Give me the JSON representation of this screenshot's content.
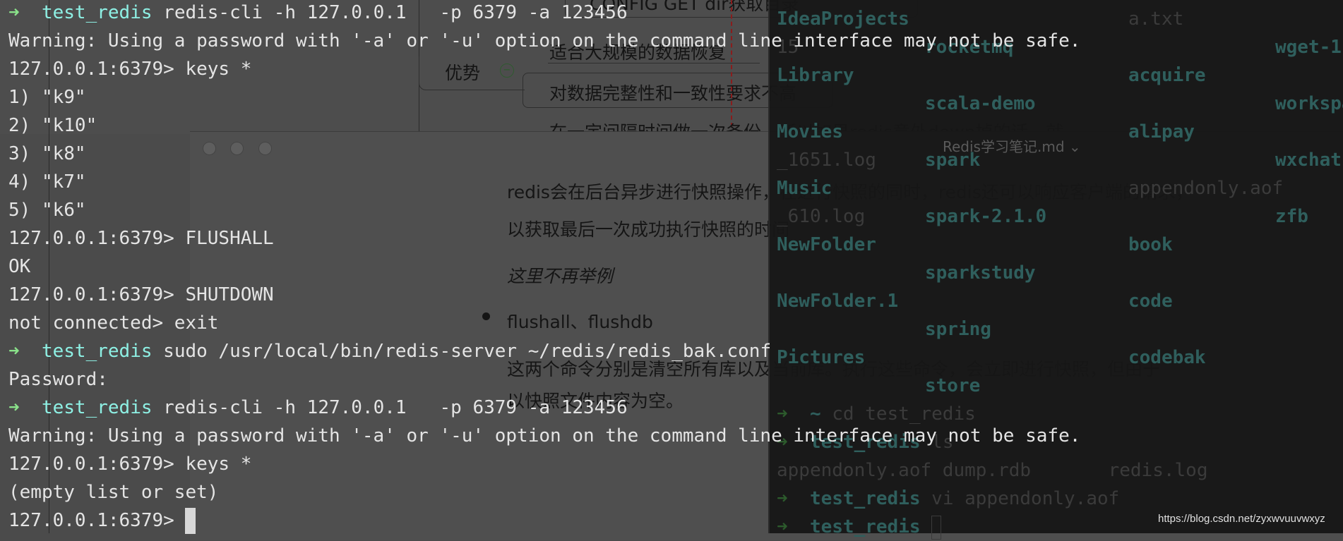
{
  "mindmap": {
    "top_box": "CONFIG GET dir获取目录",
    "item_recovery": "适合大规模的数据恢复",
    "advantage_label": "优势",
    "collapse_icon": "minus-circle-icon",
    "item_integrity": "对数据完整性和一致性要求不高",
    "partial_line": "在一定间隔时间做一次备份，所以如果redis意外down掉的话，就"
  },
  "markdown_window": {
    "title": "Redis学习笔记.md ⌄",
    "paragraph1": "redis会在后台异步进行快照操作，在进行快照的同时，redis还可以响应客户端的请求，",
    "paragraph1b": "以获取最后一次成功执行快照的时间",
    "italic_note": "这里不再举例",
    "bullet": "flushall、flushdb",
    "paragraph2": "这两个命令分别是清空所有库以及当前库。执行这些命令，会立即进行快照，但由于",
    "paragraph2b": "以快照文件内容为空。"
  },
  "background_terminal": {
    "ls_rows": [
      [
        [
          "IdeaProjects",
          "dir"
        ],
        null,
        [
          "a.txt",
          "file"
        ],
        null
      ],
      [
        [
          "15",
          "file"
        ],
        [
          "rocketmq",
          "dir"
        ],
        null,
        [
          "wget-1",
          "dir"
        ]
      ],
      [
        [
          "Library",
          "dir"
        ],
        null,
        [
          "acquire",
          "dir"
        ],
        null
      ],
      [
        null,
        [
          "scala-demo",
          "dir"
        ],
        null,
        [
          "workspa",
          "dir"
        ]
      ],
      [
        [
          "Movies",
          "dir"
        ],
        null,
        [
          "alipay",
          "dir"
        ],
        null
      ],
      [
        [
          "_1651.log",
          "file"
        ],
        [
          "spark",
          "dir"
        ],
        null,
        [
          "wxchat",
          "dir"
        ]
      ],
      [
        [
          "Music",
          "dir"
        ],
        null,
        [
          "appendonly.aof",
          "file"
        ],
        null
      ],
      [
        [
          "_610.log",
          "file"
        ],
        [
          "spark-2.1.0",
          "dir"
        ],
        null,
        [
          "zfb",
          "dir"
        ]
      ],
      [
        [
          "NewFolder",
          "dir"
        ],
        null,
        [
          "book",
          "dir"
        ],
        null
      ],
      [
        null,
        [
          "sparkstudy",
          "dir"
        ],
        null,
        null
      ],
      [
        [
          "NewFolder.1",
          "dir"
        ],
        null,
        [
          "code",
          "dir"
        ],
        null
      ],
      [
        null,
        [
          "spring",
          "dir"
        ],
        null,
        null
      ],
      [
        [
          "Pictures",
          "dir"
        ],
        null,
        [
          "codebak",
          "dir"
        ],
        null
      ],
      [
        null,
        [
          "store",
          "dir"
        ],
        null,
        null
      ]
    ],
    "history": [
      {
        "arrow": "➜",
        "dir": "~",
        "text": " cd test_redis"
      },
      {
        "arrow": "➜",
        "dir": "test_redis",
        "text": " ls"
      },
      {
        "text": "appendonly.aof dump.rdb       redis.log"
      },
      {
        "arrow": "➜",
        "dir": "test_redis",
        "text": " vi appendonly.aof"
      },
      {
        "arrow": "➜",
        "dir": "test_redis",
        "text": " ",
        "cursor": true
      }
    ]
  },
  "terminal": {
    "lines": [
      {
        "arrow": "➜",
        "dir": "test_redis",
        "text": " redis-cli -h 127.0.0.1   -p 6379 -a 123456"
      },
      {
        "text": "Warning: Using a password with '-a' or '-u' option on the command line interface may not be safe."
      },
      {
        "text": "127.0.0.1:6379> keys *"
      },
      {
        "text": "1) \"k9\""
      },
      {
        "text": "2) \"k10\""
      },
      {
        "text": "3) \"k8\""
      },
      {
        "text": "4) \"k7\""
      },
      {
        "text": "5) \"k6\""
      },
      {
        "text": "127.0.0.1:6379> FLUSHALL"
      },
      {
        "text": "OK"
      },
      {
        "text": "127.0.0.1:6379> SHUTDOWN"
      },
      {
        "text": "not connected> exit"
      },
      {
        "arrow": "➜",
        "dir": "test_redis",
        "text": " sudo /usr/local/bin/redis-server ~/redis/redis_bak.conf"
      },
      {
        "text": "Password:"
      },
      {
        "arrow": "➜",
        "dir": "test_redis",
        "text": " redis-cli -h 127.0.0.1   -p 6379 -a 123456"
      },
      {
        "text": "Warning: Using a password with '-a' or '-u' option on the command line interface may not be safe."
      },
      {
        "text": "127.0.0.1:6379> keys *"
      },
      {
        "text": "(empty list or set)"
      },
      {
        "text": "127.0.0.1:6379> ",
        "cursor": true
      }
    ]
  },
  "watermark": "https://blog.csdn.net/zyxwvuuvwxyz",
  "colors": {
    "prompt_arrow": "#8ae28a",
    "prompt_dir": "#8ef0e4",
    "ls_dir": "#2f5f5d"
  }
}
